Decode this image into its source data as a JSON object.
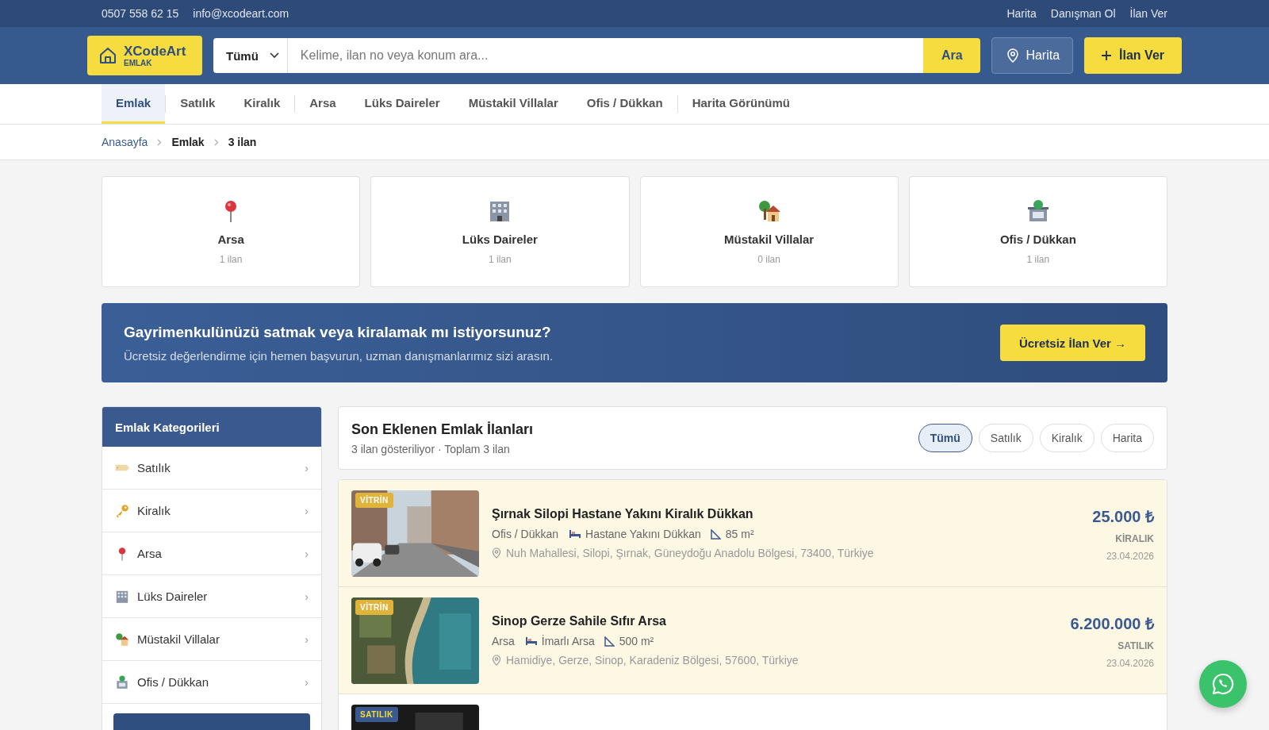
{
  "topbar": {
    "phone": "0507 558 62 15",
    "email": "info@xcodeart.com",
    "links": [
      "Harita",
      "Danışman Ol",
      "İlan Ver"
    ]
  },
  "header": {
    "logo": {
      "name": "XCodeArt",
      "sub": "EMLAK"
    },
    "search": {
      "category": "Tümü",
      "placeholder": "Kelime, ilan no veya konum ara...",
      "button": "Ara"
    },
    "map_button": "Harita",
    "post_button": "İlan Ver"
  },
  "nav": [
    {
      "label": "Emlak",
      "selected": true,
      "divider_after": true
    },
    {
      "label": "Satılık",
      "selected": false,
      "divider_after": false
    },
    {
      "label": "Kiralık",
      "selected": false,
      "divider_after": true
    },
    {
      "label": "Arsa",
      "selected": false,
      "divider_after": false
    },
    {
      "label": "Lüks Daireler",
      "selected": false,
      "divider_after": false
    },
    {
      "label": "Müstakil Villalar",
      "selected": false,
      "divider_after": false
    },
    {
      "label": "Ofis / Dükkan",
      "selected": false,
      "divider_after": true
    },
    {
      "label": "Harita Görünümü",
      "selected": false,
      "divider_after": false
    }
  ],
  "breadcrumb": [
    "Anasayfa",
    "Emlak",
    "3 ilan"
  ],
  "category_cards": [
    {
      "name": "Arsa",
      "count": "1 ilan"
    },
    {
      "name": "Lüks Daireler",
      "count": "1 ilan"
    },
    {
      "name": "Müstakil Villalar",
      "count": "0 ilan"
    },
    {
      "name": "Ofis / Dükkan",
      "count": "1 ilan"
    }
  ],
  "banner": {
    "title": "Gayrimenkulünüzü satmak veya kiralamak mı istiyorsunuz?",
    "text": "Ücretsiz değerlendirme için hemen başvurun, uzman danışmanlarımız sizi arasın.",
    "button": "Ücretsiz İlan Ver →"
  },
  "sidebar": {
    "title": "Emlak Kategorileri",
    "items": [
      {
        "label": "Satılık",
        "chevron": "›"
      },
      {
        "label": "Kiralık",
        "chevron": "›"
      },
      {
        "label": "Arsa",
        "chevron": "›"
      },
      {
        "label": "Lüks Daireler",
        "chevron": "›"
      },
      {
        "label": "Müstakil Villalar",
        "chevron": "›"
      },
      {
        "label": "Ofis / Dükkan",
        "chevron": "›"
      }
    ]
  },
  "listings_panel": {
    "title": "Son Eklenen Emlak İlanları",
    "subtitle": "3 ilan gösteriliyor · Toplam 3 ilan",
    "filters": [
      {
        "label": "Tümü",
        "selected": true
      },
      {
        "label": "Satılık",
        "selected": false
      },
      {
        "label": "Kiralık",
        "selected": false
      },
      {
        "label": "Harita",
        "selected": false
      }
    ]
  },
  "listings": [
    {
      "badge": {
        "text": "VİTRİN",
        "kind": "featured"
      },
      "featured": true,
      "title": "Şırnak Silopi Hastane Yakını Kiralık Dükkan",
      "category": "Ofis / Dükkan",
      "feature": "Hastane Yakını Dükkan",
      "area": "85 m²",
      "address": "Nuh Mahallesi, Silopi, Şırnak, Güneydoğu Anadolu Bölgesi, 73400, Türkiye",
      "price": "25.000 ₺",
      "type": "KİRALIK",
      "date": "23.04.2026"
    },
    {
      "badge": {
        "text": "VİTRİN",
        "kind": "featured"
      },
      "featured": true,
      "title": "Sinop Gerze Sahile Sıfır Arsa",
      "category": "Arsa",
      "feature": "İmarlı Arsa",
      "area": "500 m²",
      "address": "Hamidiye, Gerze, Sinop, Karadeniz Bölgesi, 57600, Türkiye",
      "price": "6.200.000 ₺",
      "type": "SATILIK",
      "date": "23.04.2026"
    },
    {
      "badge": {
        "text": "SATILIK",
        "kind": "sale"
      },
      "featured": false
    }
  ]
}
